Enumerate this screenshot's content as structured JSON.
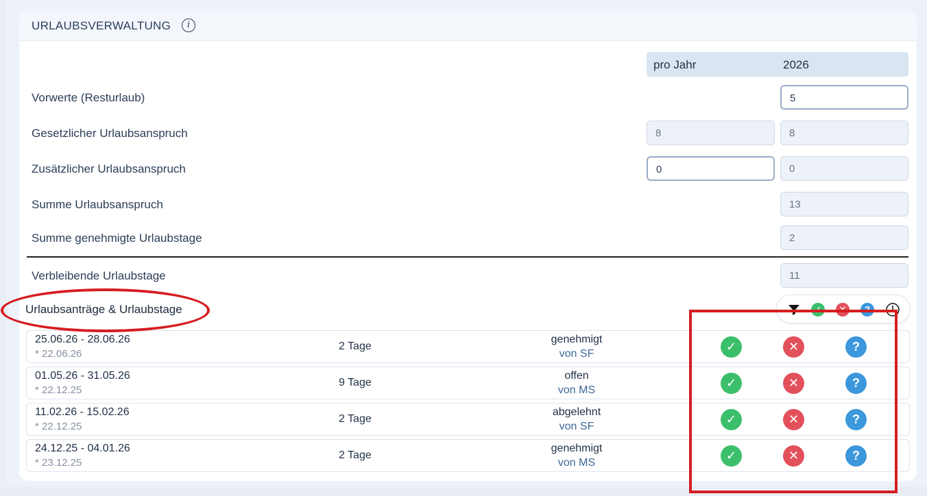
{
  "header": {
    "title": "URLAUBSVERWALTUNG",
    "info_icon": "info-icon"
  },
  "columns": {
    "per_year": "pro Jahr",
    "year": "2026"
  },
  "rows": [
    {
      "label": "Vorwerte (Resturlaub)",
      "year_value": "5"
    },
    {
      "label": "Gesetzlicher Urlaubsanspruch",
      "per_year_value": "8",
      "year_value": "8"
    },
    {
      "label": "Zusätzlicher Urlaubsanspruch",
      "per_year_value": "0",
      "year_value": "0"
    },
    {
      "label": "Summe Urlaubsanspruch",
      "year_value": "13"
    },
    {
      "label": "Summe genehmigte Urlaubstage",
      "year_value": "2"
    },
    {
      "label": "Verbleibende Urlaubstage",
      "year_value": "11"
    }
  ],
  "requests_section": {
    "title": "Urlaubsanträge & Urlaubstage",
    "filter_icons": [
      "filter-icon",
      "approved-icon",
      "rejected-icon",
      "question-icon",
      "clock-icon"
    ]
  },
  "requests": [
    {
      "dates": "25.06.26 - 28.06.26",
      "created": "* 22.06.26",
      "days": "2 Tage",
      "status": "genehmigt",
      "by": "von SF"
    },
    {
      "dates": "01.05.26 - 31.05.26",
      "created": "* 22.12.25",
      "days": "9 Tage",
      "status": "offen",
      "by": "von MS"
    },
    {
      "dates": "11.02.26 - 15.02.26",
      "created": "* 22.12.25",
      "days": "2 Tage",
      "status": "abgelehnt",
      "by": "von SF"
    },
    {
      "dates": "24.12.25 - 04.01.26",
      "created": "* 23.12.25",
      "days": "2 Tage",
      "status": "genehmigt",
      "by": "von MS"
    }
  ],
  "colors": {
    "approve": "#3cbf6b",
    "reject": "#e2505b",
    "question": "#3c97dc",
    "annotation": "#d61d21"
  }
}
